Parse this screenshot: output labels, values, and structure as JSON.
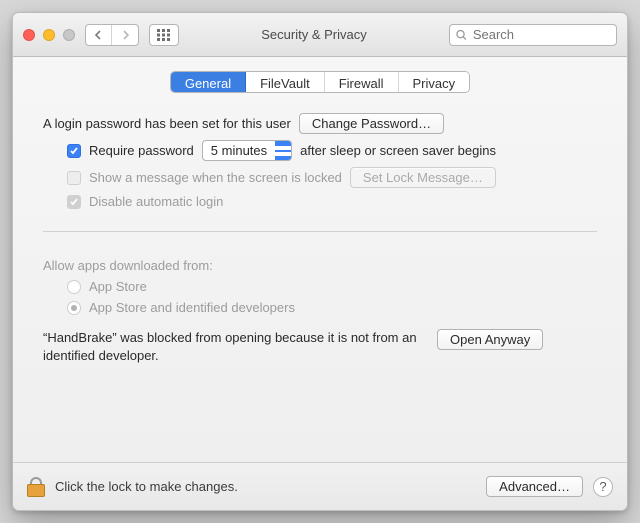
{
  "window": {
    "title": "Security & Privacy"
  },
  "search": {
    "placeholder": "Search"
  },
  "tabs": [
    {
      "label": "General",
      "active": true
    },
    {
      "label": "FileVault",
      "active": false
    },
    {
      "label": "Firewall",
      "active": false
    },
    {
      "label": "Privacy",
      "active": false
    }
  ],
  "login": {
    "password_set_text": "A login password has been set for this user",
    "change_password_label": "Change Password…",
    "require_password_checked": true,
    "require_password_label": "Require password",
    "require_password_delay": "5 minutes",
    "require_password_suffix": "after sleep or screen saver begins",
    "show_message_checked": false,
    "show_message_label": "Show a message when the screen is locked",
    "set_lock_message_label": "Set Lock Message…",
    "disable_auto_login_checked": true,
    "disable_auto_login_label": "Disable automatic login"
  },
  "gatekeeper": {
    "heading": "Allow apps downloaded from:",
    "options": [
      {
        "label": "App Store",
        "selected": false
      },
      {
        "label": "App Store and identified developers",
        "selected": true
      }
    ],
    "blocked_message": "“HandBrake” was blocked from opening because it is not from an identified developer.",
    "open_anyway_label": "Open Anyway"
  },
  "footer": {
    "lock_text": "Click the lock to make changes.",
    "advanced_label": "Advanced…",
    "help_label": "?"
  }
}
